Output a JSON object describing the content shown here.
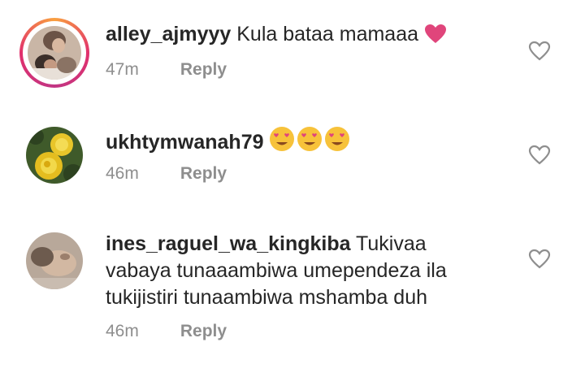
{
  "comments": [
    {
      "username": "alley_ajmyyy",
      "text": "Kula bataa mamaaa",
      "emoji": "heart",
      "time": "47m",
      "reply": "Reply"
    },
    {
      "username": "ukhtymwanah79",
      "text": "",
      "emoji": "heart-eyes x3",
      "time": "46m",
      "reply": "Reply"
    },
    {
      "username": "ines_raguel_wa_kingkiba",
      "text_line1": "Tukivaa",
      "text_line2": "vabaya tunaaambiwa umependeza ila",
      "text_line3": "tukijistiri tunaambiwa mshamba duh",
      "time": "46m",
      "reply": "Reply"
    }
  ],
  "colors": {
    "text": "#262626",
    "meta": "#8e8e8e",
    "heart_emoji": "#e0457b",
    "story_ring": "#e1306c"
  }
}
